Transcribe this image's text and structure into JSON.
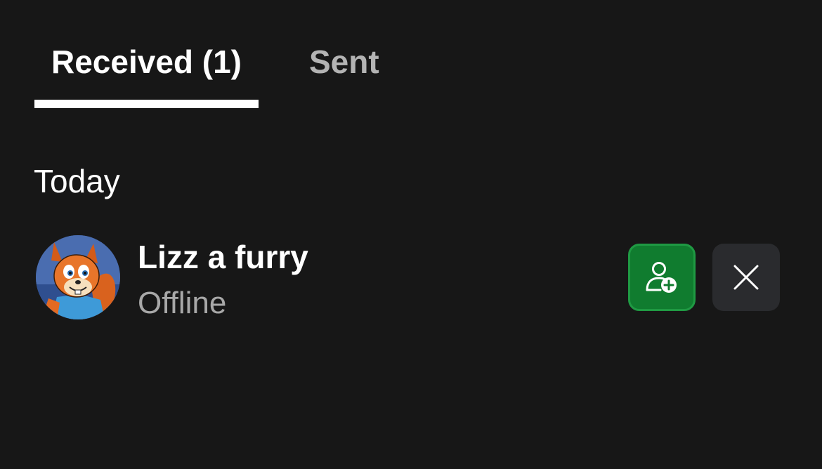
{
  "tabs": {
    "received_label": "Received (1)",
    "sent_label": "Sent",
    "active": "received"
  },
  "section": {
    "header": "Today"
  },
  "requests": [
    {
      "name": "Lizz a furry",
      "status": "Offline",
      "avatar_icon": "squirrel-cartoon-avatar",
      "accept_icon": "add-friend-icon",
      "decline_icon": "close-icon"
    }
  ],
  "colors": {
    "background": "#171717",
    "accent_green": "#107c2f",
    "decline_bg": "#2a2b2e",
    "inactive_tab": "#b3b3b3",
    "status_text": "#a8a8a8"
  }
}
